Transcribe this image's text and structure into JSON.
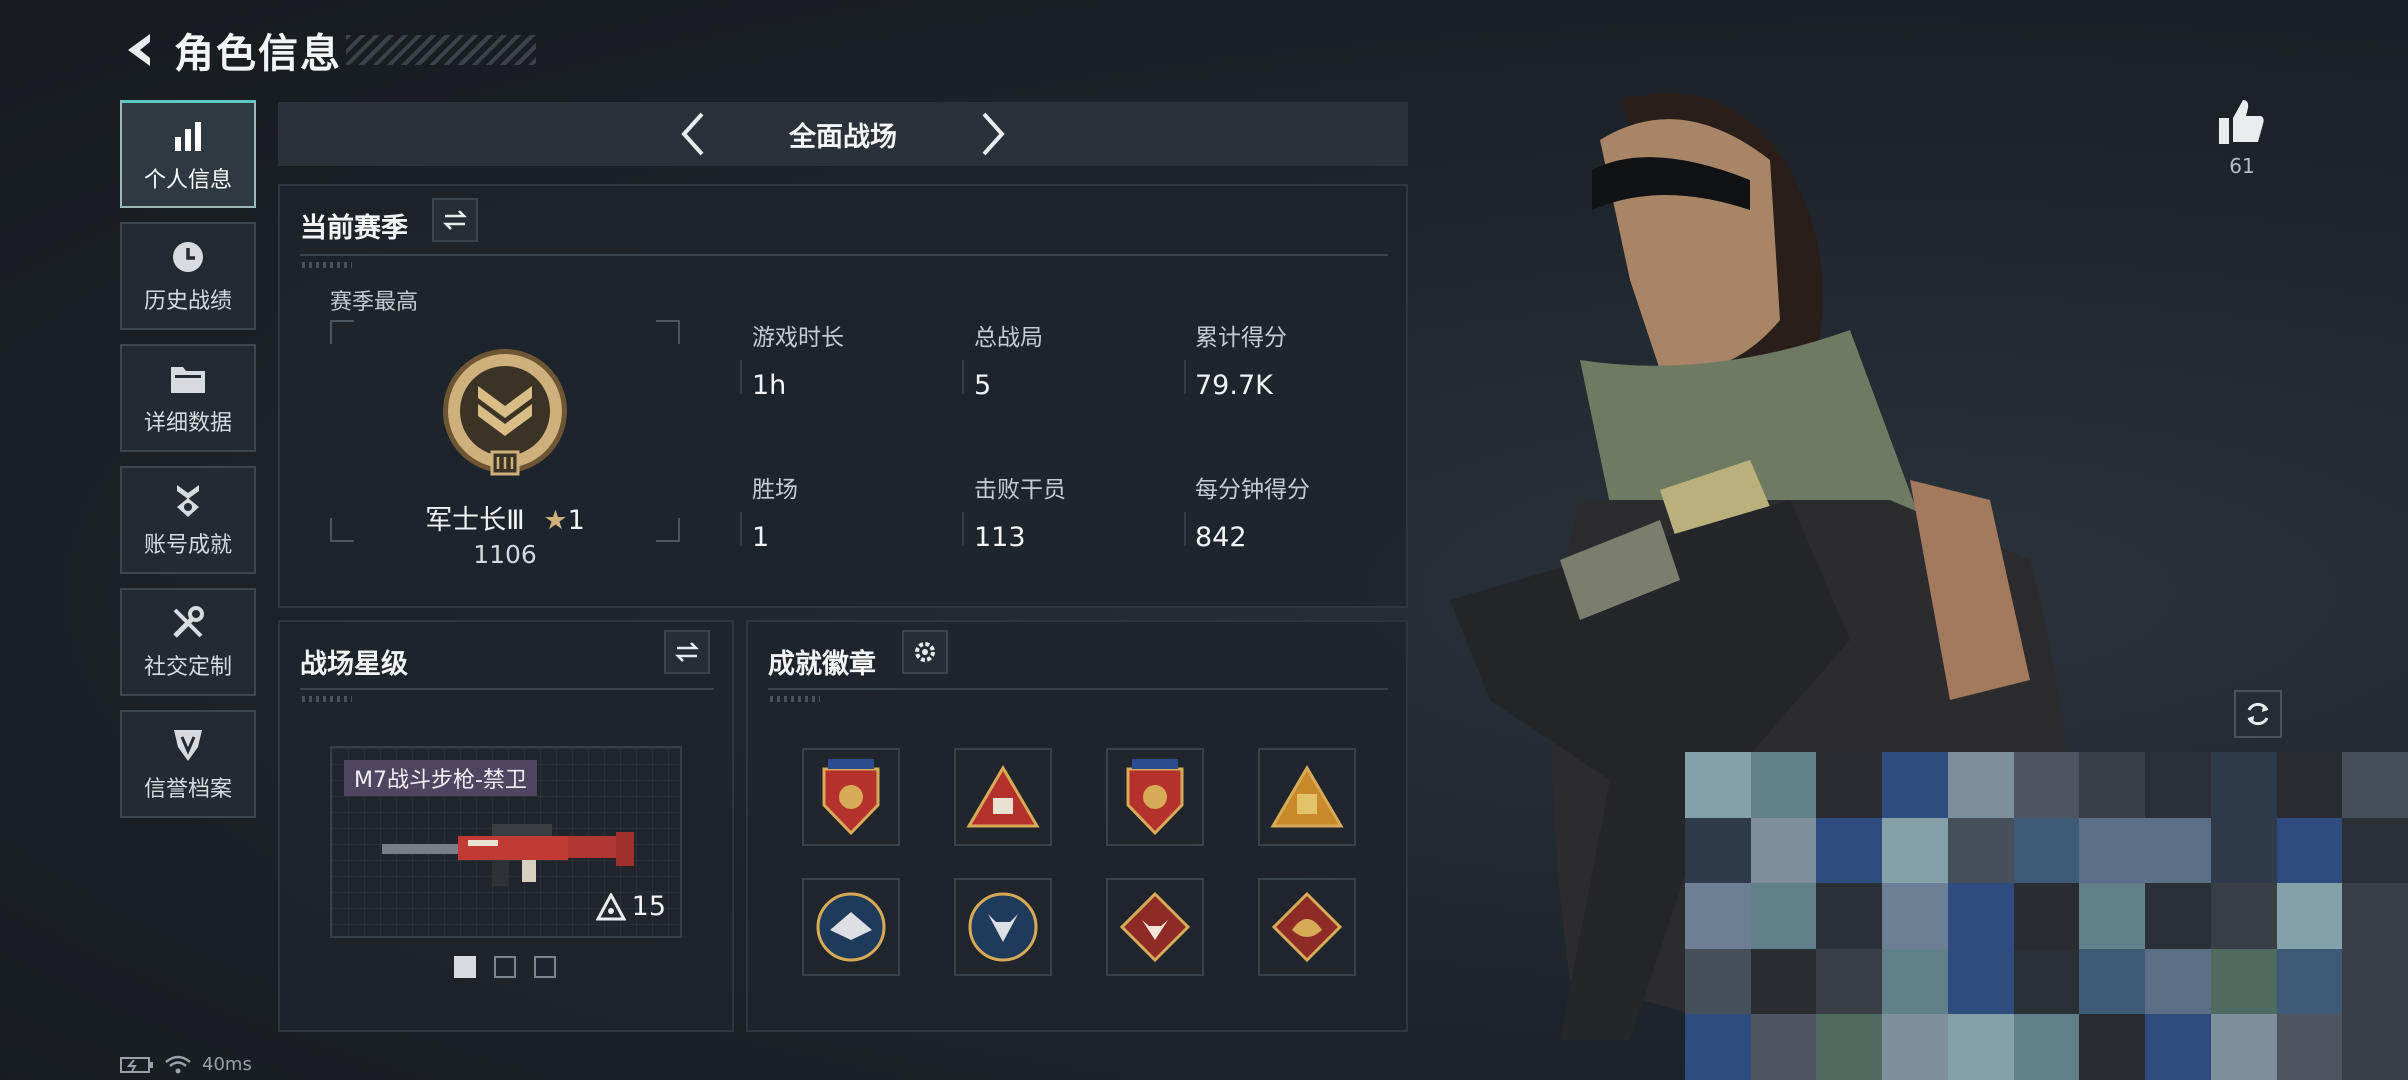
{
  "header": {
    "title": "角色信息"
  },
  "sidebar": {
    "items": [
      {
        "label": "个人信息",
        "icon": "bar-chart-icon",
        "active": true
      },
      {
        "label": "历史战绩",
        "icon": "clock-icon"
      },
      {
        "label": "详细数据",
        "icon": "folder-icon"
      },
      {
        "label": "账号成就",
        "icon": "medal-icon"
      },
      {
        "label": "社交定制",
        "icon": "wrench-icon"
      },
      {
        "label": "信誉档案",
        "icon": "shield-icon"
      }
    ]
  },
  "mode": {
    "title": "全面战场"
  },
  "season": {
    "title": "当前赛季",
    "best_label": "赛季最高",
    "rank_name": "军士长Ⅲ",
    "rank_stars": "1",
    "rank_points": "1106",
    "stats": [
      {
        "label": "游戏时长",
        "value": "1h"
      },
      {
        "label": "总战局",
        "value": "5"
      },
      {
        "label": "累计得分",
        "value": "79.7K"
      },
      {
        "label": "胜场",
        "value": "1"
      },
      {
        "label": "击败干员",
        "value": "113"
      },
      {
        "label": "每分钟得分",
        "value": "842"
      }
    ]
  },
  "star_level": {
    "title": "战场星级",
    "weapon_name": "M7战斗步枪-禁卫",
    "weapon_level": "15",
    "pages": 3,
    "current_page": 1
  },
  "achievements": {
    "title": "成就徽章",
    "badge_count": 8
  },
  "likes": {
    "count": "61"
  },
  "status_bar": {
    "ping": "40ms"
  },
  "colors": {
    "accent": "#60c8c3",
    "gold": "#c9a66b",
    "panel": "#1f252b"
  }
}
